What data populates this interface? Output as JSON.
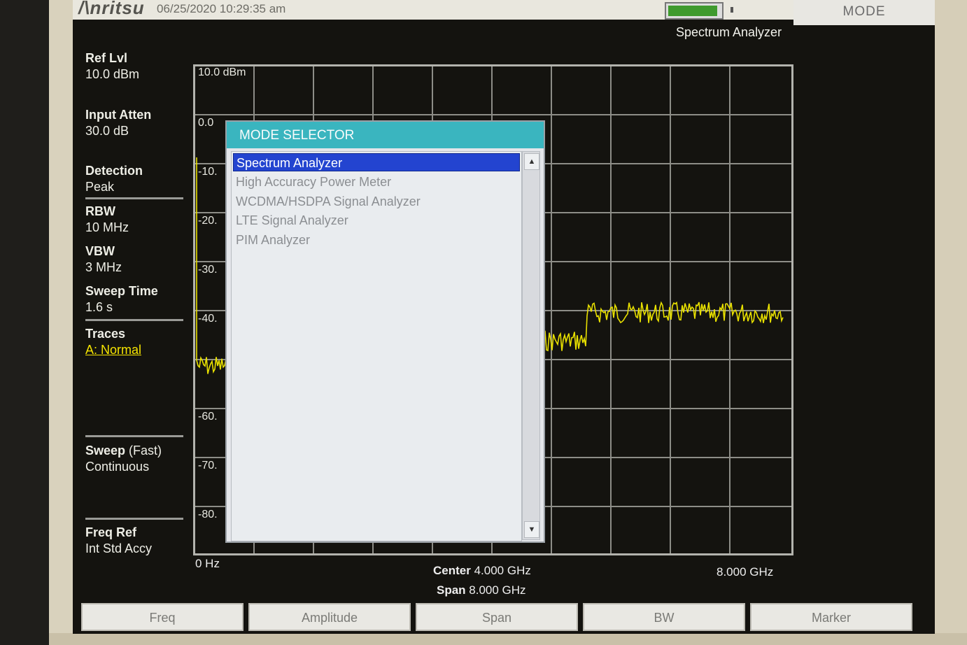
{
  "header": {
    "brand": "/\\nritsu",
    "datetime": "06/25/2020 10:29:35 am",
    "mode_title": "MODE",
    "mode_name": "Spectrum Analyzer"
  },
  "params": {
    "ref_lvl_label": "Ref Lvl",
    "ref_lvl_value": "10.0 dBm",
    "input_atten_label": "Input Atten",
    "input_atten_value": "30.0 dB",
    "detection_label": "Detection",
    "detection_value": "Peak",
    "rbw_label": "RBW",
    "rbw_value": "10 MHz",
    "vbw_label": "VBW",
    "vbw_value": "3 MHz",
    "sweep_time_label": "Sweep Time",
    "sweep_time_value": "1.6 s",
    "traces_label": "Traces",
    "traces_value": "A: Normal",
    "sweep_label": "Sweep",
    "sweep_mode": "(Fast)",
    "sweep_value": "Continuous",
    "freq_ref_label": "Freq Ref",
    "freq_ref_value": "Int Std Accy"
  },
  "graticule": {
    "ref_label": "10.0 dBm",
    "y_labels": [
      "0.0",
      "-10.",
      "-20.",
      "-30.",
      "-40.",
      "",
      "-60.",
      "-70.",
      "-80."
    ]
  },
  "axis": {
    "start": "0 Hz",
    "stop": "8.000 GHz",
    "center_label": "Center",
    "center_value": "4.000 GHz",
    "span_label": "Span",
    "span_value": "8.000 GHz"
  },
  "dialog": {
    "title": "MODE SELECTOR",
    "items": [
      "Spectrum Analyzer",
      "High Accuracy Power Meter",
      "WCDMA/HSDPA Signal Analyzer",
      "LTE Signal Analyzer",
      "PIM Analyzer"
    ],
    "selected_index": 0
  },
  "softkeys": [
    "Freq",
    "Amplitude",
    "Span",
    "BW",
    "Marker"
  ],
  "colors": {
    "trace": "#e8e000",
    "dialog_title": "#3ab5bf",
    "selection": "#2344d0"
  }
}
